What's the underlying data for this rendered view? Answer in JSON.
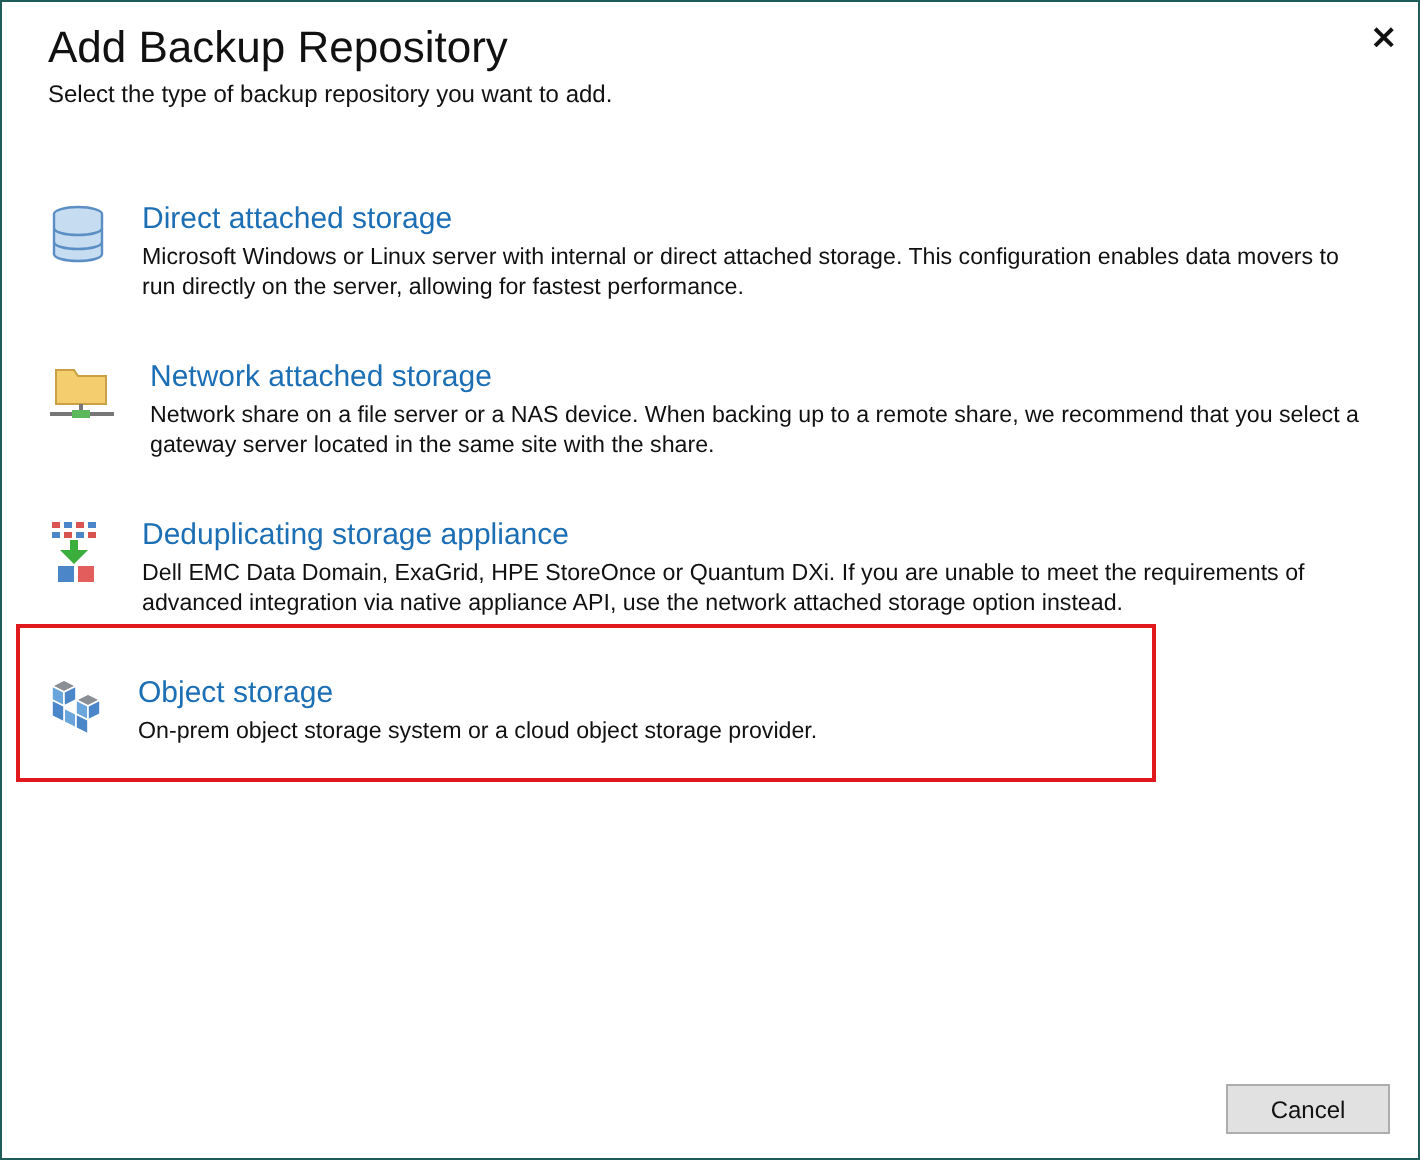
{
  "window": {
    "title": "Add Backup Repository",
    "subtitle": "Select the type of backup repository you want to add.",
    "close": "×"
  },
  "options": [
    {
      "kind": "block",
      "title": "Direct attached storage",
      "description": "Microsoft Windows or Linux server with internal or direct attached storage. This configuration enables data movers to run directly on the server, allowing for fastest performance.",
      "highlighted": false
    },
    {
      "kind": "nas",
      "title": "Network attached storage",
      "description": "Network share on a file server or a NAS device. When backing up to a remote share, we recommend that you select a gateway server located in the same site with the share.",
      "highlighted": false
    },
    {
      "kind": "dedup",
      "title": "Deduplicating storage appliance",
      "description": "Dell EMC Data Domain, ExaGrid, HPE StoreOnce or Quantum DXi. If you are unable to meet the requirements of advanced integration via native appliance API, use the network attached storage option instead.",
      "highlighted": false
    },
    {
      "kind": "object",
      "title": "Object storage",
      "description": "On-prem object storage system or a cloud object storage provider.",
      "highlighted": true
    }
  ],
  "buttons": [
    "Cancel"
  ]
}
